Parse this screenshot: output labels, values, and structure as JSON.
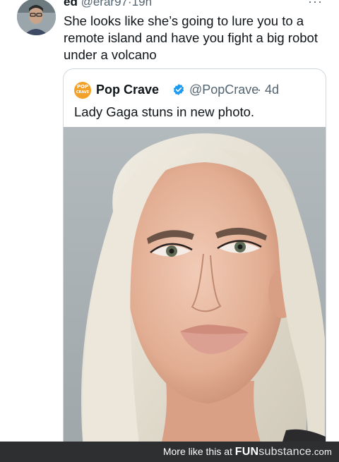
{
  "reply": {
    "author": "ed",
    "handle": "@erar97",
    "separator": "·",
    "time": "19h",
    "more_icon": "more-options-icon",
    "text": "She looks like she’s going to lure you to a remote island and have you fight a big robot under a volcano"
  },
  "quote": {
    "logo_line1": "POP",
    "logo_line2": "CRAVE",
    "author": "Pop Crave",
    "verified_icon": "verified-badge-icon",
    "handle": "@PopCrave",
    "separator": "·",
    "time": "4d",
    "text": "Lady Gaga stuns in new photo.",
    "colors": {
      "logo": "#f4a12a",
      "verified": "#1d9bf0"
    }
  },
  "footer": {
    "prefix": "More like this at",
    "site_a": "FUN",
    "site_b": "substance",
    "site_c": ".com",
    "background": "#2e2f30"
  }
}
